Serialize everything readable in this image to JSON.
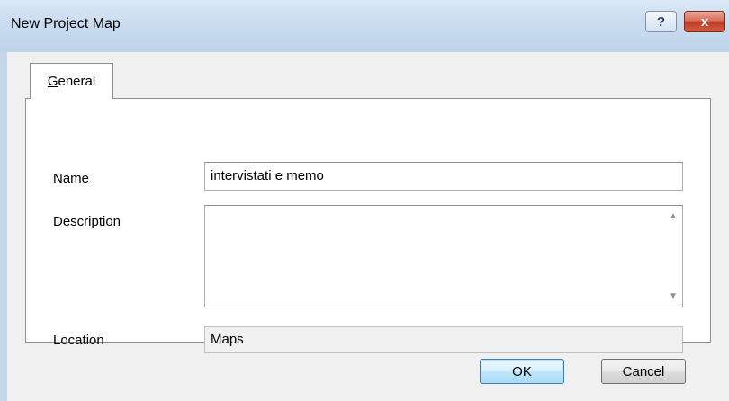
{
  "window": {
    "title": "New Project Map",
    "help_glyph": "?",
    "close_glyph": "x"
  },
  "tabs": [
    {
      "label_mnemonic": "G",
      "label_rest": "eneral",
      "active": true
    }
  ],
  "form": {
    "name": {
      "label": "Name",
      "value": "intervistati e memo"
    },
    "description": {
      "label": "Description",
      "value": ""
    },
    "location": {
      "label": "Location",
      "value": "Maps"
    }
  },
  "buttons": {
    "ok": "OK",
    "cancel": "Cancel"
  },
  "colors": {
    "titlebar": "#c4d6ea",
    "close_button": "#c23b22",
    "default_button_border": "#3c7fb1"
  },
  "icons": {
    "scroll_up": "triangle-up",
    "scroll_down": "triangle-down"
  }
}
